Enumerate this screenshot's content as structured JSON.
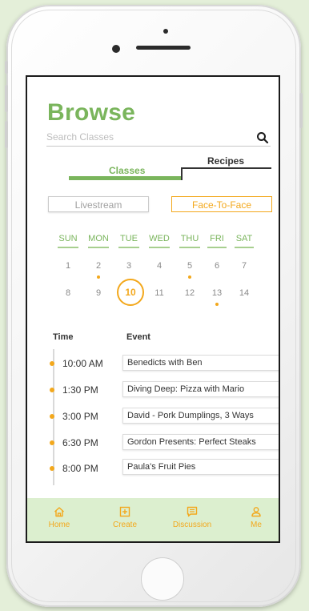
{
  "browse": {
    "title": "Browse",
    "search_placeholder": "Search Classes"
  },
  "tabs": {
    "classes": "Classes",
    "recipes": "Recipes",
    "active": "Classes"
  },
  "mode_toggle": {
    "livestream": "Livestream",
    "face_to_face": "Face-To-Face",
    "active": "Face-To-Face"
  },
  "calendar": {
    "weekdays": [
      "SUN",
      "MON",
      "TUE",
      "WED",
      "THU",
      "FRI",
      "SAT"
    ],
    "week1": [
      "1",
      "2",
      "3",
      "4",
      "5",
      "6",
      "7"
    ],
    "week2": [
      "8",
      "9",
      "10",
      "11",
      "12",
      "13",
      "14"
    ],
    "selected_day": "10",
    "days_with_events": [
      "2",
      "5",
      "13"
    ]
  },
  "schedule": {
    "time_header": "Time",
    "event_header": "Event",
    "items": [
      {
        "time": "10:00 AM",
        "event": "Benedicts with Ben"
      },
      {
        "time": "1:30 PM",
        "event": "Diving Deep: Pizza with Mario"
      },
      {
        "time": "3:00 PM",
        "event": "David - Pork Dumplings, 3 Ways"
      },
      {
        "time": "6:30 PM",
        "event": "Gordon Presents: Perfect Steaks"
      },
      {
        "time": "8:00 PM",
        "event": "Paula's Fruit Pies"
      }
    ]
  },
  "nav": {
    "home": "Home",
    "create": "Create",
    "discussion": "Discussion",
    "me": "Me"
  },
  "colors": {
    "brand_green": "#7ab55c",
    "accent_orange": "#f3a81c",
    "nav_background": "#dcefcf",
    "page_background": "#e4efd9"
  },
  "icons": {
    "search": "search-icon",
    "home": "home-icon",
    "create": "plus-square-icon",
    "discussion": "chat-icon",
    "me": "user-icon"
  }
}
